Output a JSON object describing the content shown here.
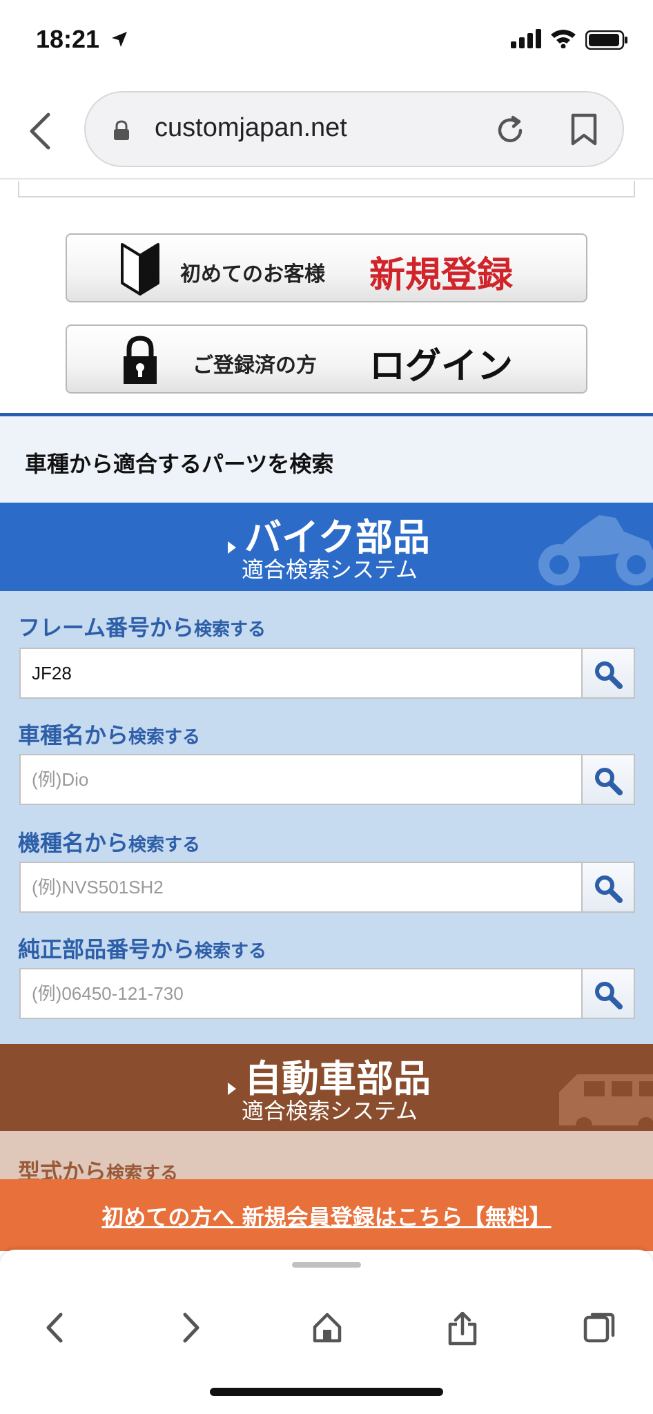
{
  "status_bar": {
    "time": "18:21"
  },
  "browser": {
    "url": "customjapan.net"
  },
  "register_button": {
    "sub": "初めてのお客様",
    "main": "新規登録"
  },
  "login_button": {
    "sub": "ご登録済の方",
    "main": "ログイン"
  },
  "search_section": {
    "title": "車種から適合するパーツを検索"
  },
  "bike_banner": {
    "main": "バイク部品",
    "sub": "適合検索システム"
  },
  "bike_fields": [
    {
      "label": "フレーム番号から",
      "suffix": "検索する",
      "value": "JF28",
      "placeholder": ""
    },
    {
      "label": "車種名から",
      "suffix": "検索する",
      "value": "",
      "placeholder": "(例)Dio"
    },
    {
      "label": "機種名から",
      "suffix": "検索する",
      "value": "",
      "placeholder": "(例)NVS501SH2"
    },
    {
      "label": "純正部品番号から",
      "suffix": "検索する",
      "value": "",
      "placeholder": "(例)06450-121-730"
    }
  ],
  "car_banner": {
    "main": "自動車部品",
    "sub": "適合検索システム"
  },
  "car_fields": [
    {
      "label": "型式から",
      "suffix": "検索する"
    }
  ],
  "cta": {
    "text": "初めての方へ 新規会員登録はこちら【無料】"
  },
  "icons": {
    "back": "chevron-left-icon",
    "forward": "chevron-right-icon",
    "home": "home-icon",
    "share": "share-icon",
    "tabs": "tabs-icon",
    "search": "magnifier-icon",
    "lock": "lock-icon",
    "reload": "reload-icon",
    "bookmark": "bookmark-icon"
  },
  "colors": {
    "bike_blue": "#2c6cc8",
    "bike_panel": "#c6daf0",
    "label_blue": "#2d5ea8",
    "car_brown": "#8a4e2e",
    "car_panel": "#dfc7ba",
    "cta_orange": "#e8703a",
    "register_red": "#d1232a",
    "section_line": "#2a5cb4"
  }
}
